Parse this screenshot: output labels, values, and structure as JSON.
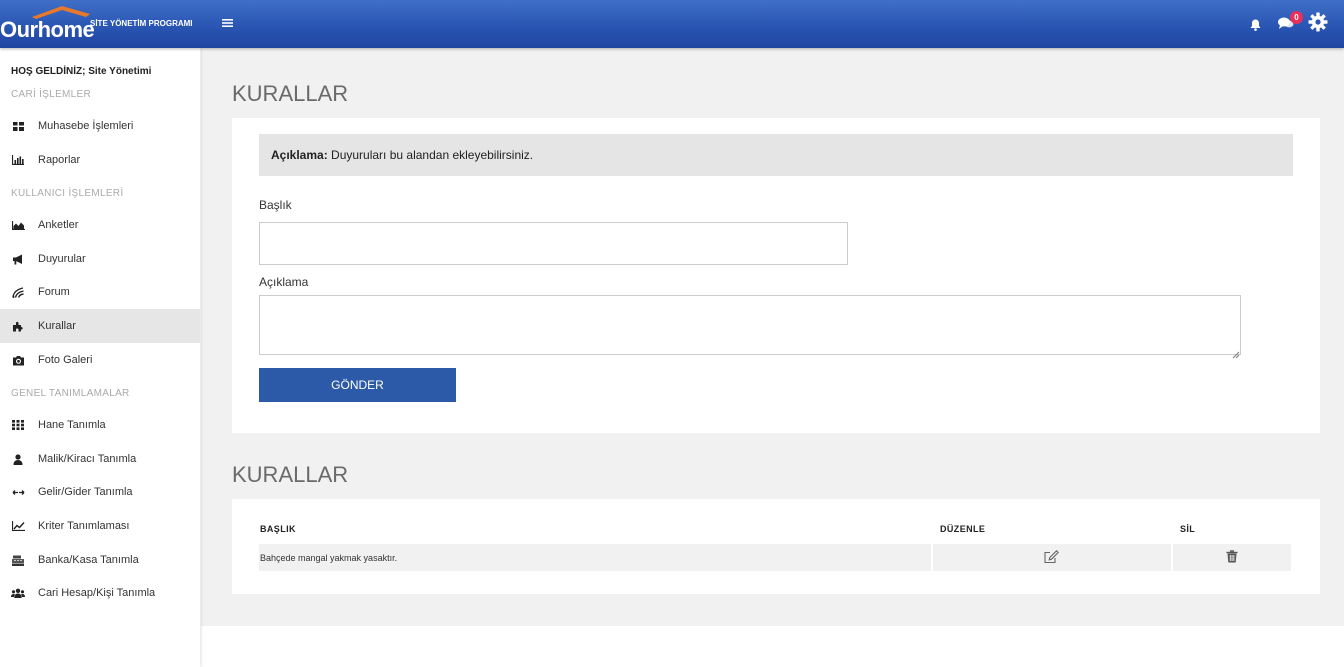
{
  "header": {
    "logo_text": "Ourhome",
    "logo_subtitle": "SİTE YÖNETİM PROGRAMI",
    "chat_badge": "0",
    "accent_color": "#2a55b3",
    "icons": [
      "menu-icon",
      "bell-icon",
      "chat-icon",
      "gear-icon"
    ]
  },
  "sidebar": {
    "welcome": "HOŞ GELDİNİZ; Site Yönetimi",
    "sections": [
      {
        "title": "CARİ İŞLEMLER",
        "items": [
          {
            "label": "Muhasebe İşlemleri",
            "icon": "dashboard-icon"
          },
          {
            "label": "Raporlar",
            "icon": "bar-chart-icon"
          }
        ]
      },
      {
        "title": "KULLANICI İŞLEMLERİ",
        "items": [
          {
            "label": "Anketler",
            "icon": "area-chart-icon"
          },
          {
            "label": "Duyurular",
            "icon": "megaphone-icon"
          },
          {
            "label": "Forum",
            "icon": "forum-icon"
          },
          {
            "label": "Kurallar",
            "icon": "puzzle-icon",
            "active": true
          },
          {
            "label": "Foto Galeri",
            "icon": "camera-icon"
          }
        ]
      },
      {
        "title": "GENEL TANIMLAMALAR",
        "items": [
          {
            "label": "Hane Tanımla",
            "icon": "grid-icon"
          },
          {
            "label": "Malik/Kiracı Tanımla",
            "icon": "user-icon"
          },
          {
            "label": "Gelir/Gider Tanımla",
            "icon": "exchange-icon"
          },
          {
            "label": "Kriter Tanımlaması",
            "icon": "line-chart-icon"
          },
          {
            "label": "Banka/Kasa Tanımla",
            "icon": "cash-register-icon"
          },
          {
            "label": "Cari Hesap/Kişi Tanımla",
            "icon": "users-icon"
          }
        ]
      }
    ]
  },
  "form_section": {
    "title": "KURALLAR",
    "info_label": "Açıklama:",
    "info_text": " Duyuruları bu alandan ekleyebilirsiniz.",
    "title_field_label": "Başlık",
    "title_field_value": "",
    "desc_field_label": "Açıklama",
    "desc_field_value": "",
    "submit_label": "GÖNDER",
    "submit_color": "#2c5aa8"
  },
  "list_section": {
    "title": "KURALLAR",
    "columns": [
      "BAŞLIK",
      "DÜZENLE",
      "SİL"
    ],
    "rows": [
      {
        "title": "Bahçede mangal yakmak yasaktır.",
        "edit_icon": "edit-icon",
        "delete_icon": "trash-icon"
      }
    ]
  }
}
